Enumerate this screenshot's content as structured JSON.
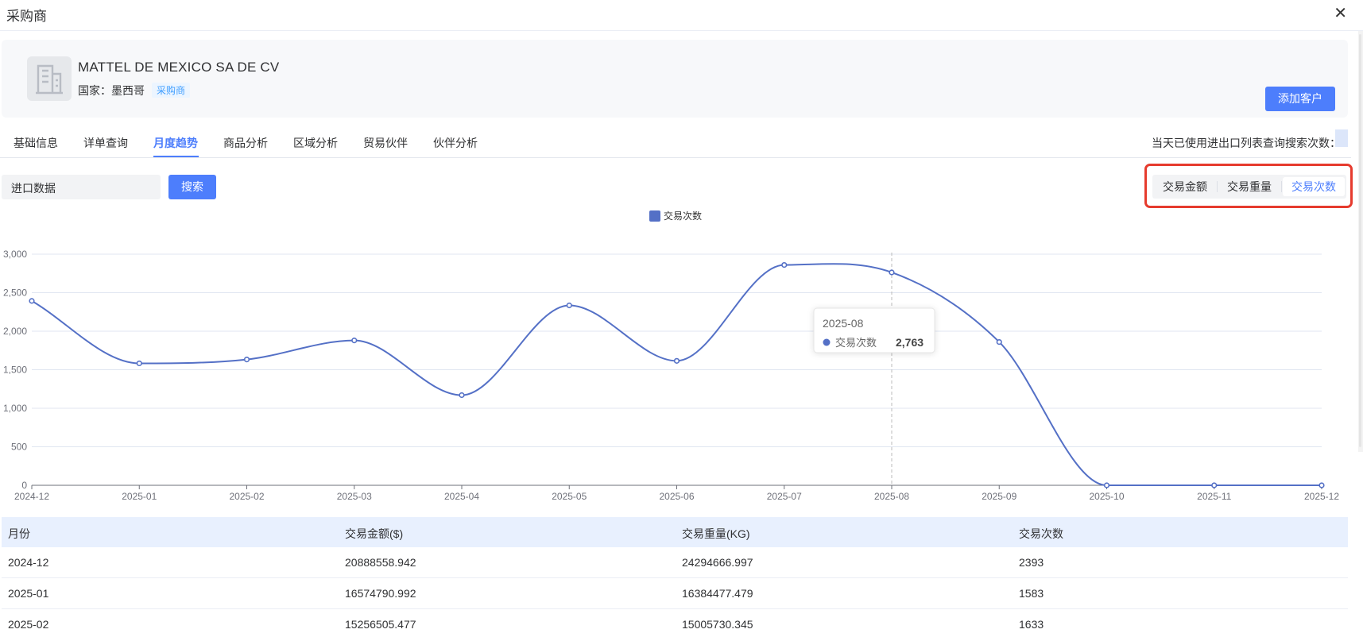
{
  "dialog": {
    "title": "采购商",
    "close_icon": "close-icon"
  },
  "company": {
    "name": "MATTEL DE MEXICO SA DE CV",
    "country_text": "国家：墨西哥",
    "tag": "采购商",
    "avatar_icon": "building-icon",
    "add_button": "添加客户"
  },
  "tabs": [
    "基础信息",
    "详单查询",
    "月度趋势",
    "商品分析",
    "区域分析",
    "贸易伙伴",
    "伙伴分析"
  ],
  "active_tab": "月度趋势",
  "quota_label": "当天已使用进出口列表查询搜索次数：",
  "filter": {
    "select_value": "进口数据",
    "search_button": "搜索"
  },
  "metric_toggle": {
    "options": [
      "交易金额",
      "交易重量",
      "交易次数"
    ],
    "active": "交易次数"
  },
  "colors": {
    "accent": "#4d7efc",
    "line": "#5470c6",
    "highlight": "#e63b2e"
  },
  "chart_data": {
    "type": "line",
    "categories": [
      "2024-12",
      "2025-01",
      "2025-02",
      "2025-03",
      "2025-04",
      "2025-05",
      "2025-06",
      "2025-07",
      "2025-08",
      "2025-09",
      "2025-10",
      "2025-11",
      "2025-12"
    ],
    "series": [
      {
        "name": "交易次数",
        "values": [
          2393,
          1583,
          1633,
          1880,
          1170,
          2335,
          1615,
          2860,
          2763,
          1860,
          0,
          0,
          0
        ]
      }
    ],
    "y_ticks": [
      "0",
      "500",
      "1,000",
      "1,500",
      "2,000",
      "2,500",
      "3,000"
    ],
    "ylim": [
      0,
      3000
    ],
    "legend": "top-center",
    "smooth": true,
    "grid": true,
    "tooltip": {
      "title": "2025-08",
      "series": "交易次数",
      "value": "2,763"
    }
  },
  "table": {
    "headers": [
      "月份",
      "交易金额($)",
      "交易重量(KG)",
      "交易次数"
    ],
    "rows": [
      [
        "2024-12",
        "20888558.942",
        "24294666.997",
        "2393"
      ],
      [
        "2025-01",
        "16574790.992",
        "16384477.479",
        "1583"
      ],
      [
        "2025-02",
        "15256505.477",
        "15005730.345",
        "1633"
      ]
    ]
  }
}
